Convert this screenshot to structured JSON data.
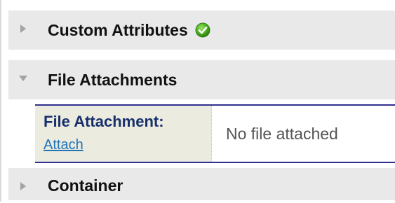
{
  "sections": [
    {
      "title": "Custom Attributes",
      "state": "collapsed",
      "status_icon": "check-circle-icon"
    },
    {
      "title": "File Attachments",
      "state": "expanded"
    },
    {
      "title": "Container",
      "state": "collapsed"
    }
  ],
  "attachment": {
    "label": "File Attachment:",
    "link": "Attach",
    "value": "No file attached"
  },
  "colors": {
    "header_bg": "#e9e9e9",
    "label_bg": "#ecebe0",
    "panel_border": "#2f2f8f",
    "link": "#1f73b7",
    "success": "#4caf1f"
  }
}
